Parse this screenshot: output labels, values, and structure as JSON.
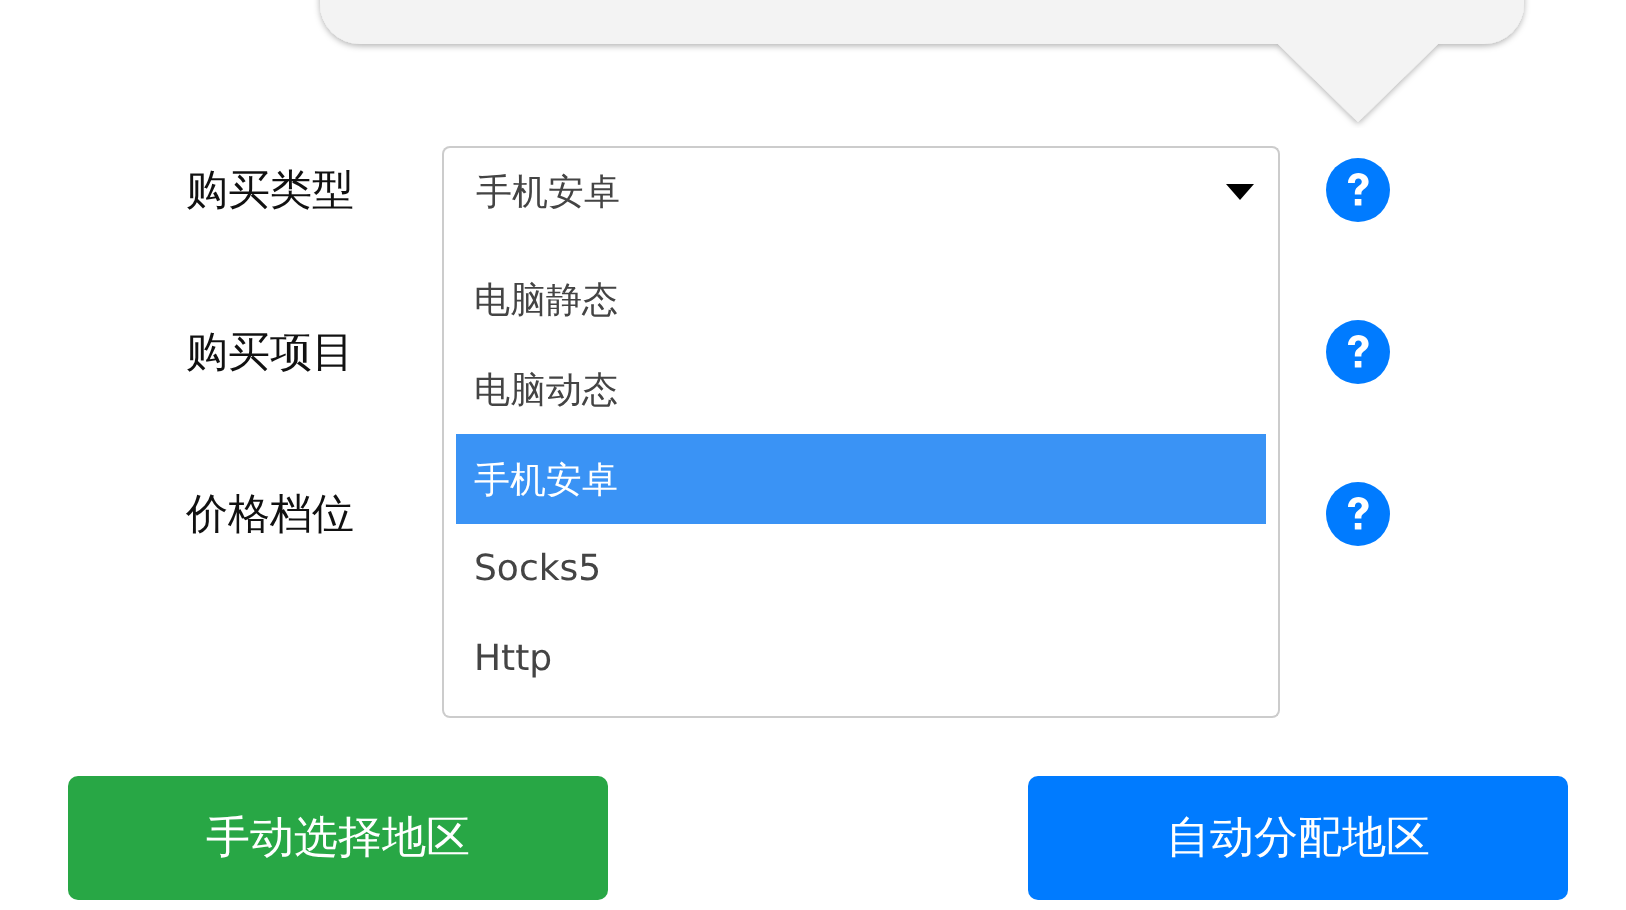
{
  "form": {
    "rows": [
      {
        "label": "购买类型",
        "select": {
          "value": "手机安卓",
          "expanded": true,
          "options": [
            {
              "label": "电脑静态",
              "selected": false
            },
            {
              "label": "电脑动态",
              "selected": false
            },
            {
              "label": "手机安卓",
              "selected": true
            },
            {
              "label": "Socks5",
              "selected": false
            },
            {
              "label": "Http",
              "selected": false
            }
          ]
        }
      },
      {
        "label": "购买项目"
      },
      {
        "label": "价格档位"
      }
    ]
  },
  "buttons": [
    {
      "label": "手动选择地区",
      "color": "#28a745"
    },
    {
      "label": "自动分配地区",
      "color": "#007bff"
    }
  ]
}
